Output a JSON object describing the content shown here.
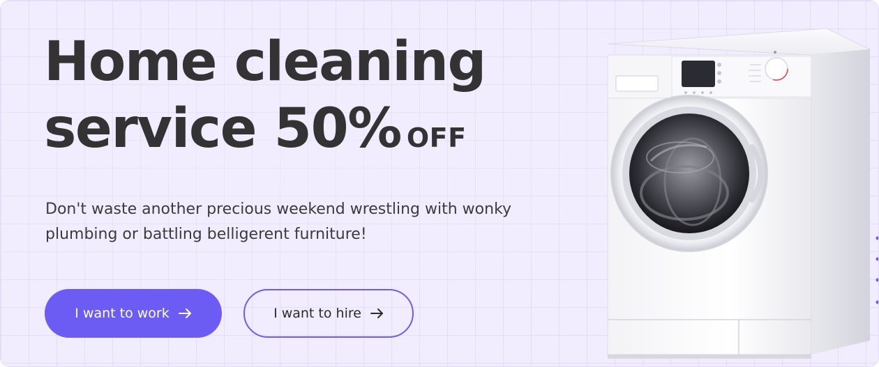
{
  "banner": {
    "headline_line1": "Home cleaning",
    "headline_line2": "service 50%",
    "headline_off": "OFF",
    "subtitle": "Don't waste another precious weekend wrestling with wonky plumbing or battling belligerent furniture!",
    "primary_button_label": "I want to work",
    "secondary_button_label": "I want to hire"
  },
  "icons": {
    "button_arrow": "arrow-right-icon",
    "product_image": "washing-machine-illustration"
  },
  "colors": {
    "background": "#f2ecff",
    "accent": "#6c5cf3",
    "headline": "#333333",
    "body_text": "#3b3b3b"
  }
}
